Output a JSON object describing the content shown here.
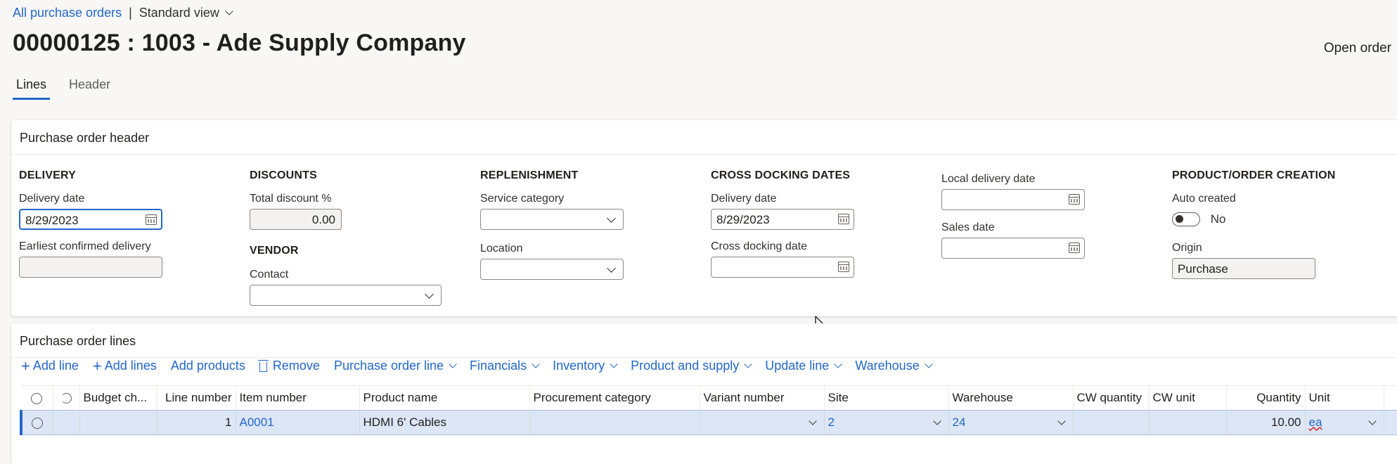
{
  "breadcrumb": {
    "link": "All purchase orders",
    "separator": "|",
    "view": "Standard view"
  },
  "page_title": "00000125 : 1003 - Ade Supply Company",
  "status": "Open order",
  "tabs": [
    "Lines",
    "Header"
  ],
  "header_section": {
    "title": "Purchase order header",
    "delivery": {
      "group": "DELIVERY",
      "delivery_date_label": "Delivery date",
      "delivery_date_value": "8/29/2023",
      "earliest_confirmed_label": "Earliest confirmed delivery",
      "earliest_confirmed_value": ""
    },
    "discounts": {
      "group": "DISCOUNTS",
      "total_discount_label": "Total discount %",
      "total_discount_value": "0.00"
    },
    "vendor": {
      "group": "VENDOR",
      "contact_label": "Contact",
      "contact_value": ""
    },
    "replenishment": {
      "group": "REPLENISHMENT",
      "service_category_label": "Service category",
      "service_category_value": "",
      "location_label": "Location",
      "location_value": ""
    },
    "cross_docking": {
      "group": "CROSS DOCKING DATES",
      "delivery_date_label": "Delivery date",
      "delivery_date_value": "8/29/2023",
      "cross_docking_date_label": "Cross docking date",
      "cross_docking_date_value": ""
    },
    "local_dates": {
      "local_delivery_label": "Local delivery date",
      "local_delivery_value": "",
      "sales_date_label": "Sales date",
      "sales_date_value": ""
    },
    "product_order": {
      "group": "PRODUCT/ORDER CREATION",
      "auto_created_label": "Auto created",
      "auto_created_value": "No",
      "origin_label": "Origin",
      "origin_value": "Purchase"
    }
  },
  "lines_section": {
    "title": "Purchase order lines",
    "toolbar": {
      "add_line": "Add line",
      "add_lines": "Add lines",
      "add_products": "Add products",
      "remove": "Remove",
      "po_line": "Purchase order line",
      "financials": "Financials",
      "inventory": "Inventory",
      "product_supply": "Product and supply",
      "update_line": "Update line",
      "warehouse": "Warehouse"
    },
    "columns": [
      "Budget ch...",
      "Line number",
      "Item number",
      "Product name",
      "Procurement category",
      "Variant number",
      "Site",
      "Warehouse",
      "CW quantity",
      "CW unit",
      "Quantity",
      "Unit"
    ],
    "rows": [
      {
        "budget": "",
        "line_number": "1",
        "item_number": "A0001",
        "product_name": "HDMI 6' Cables",
        "procurement_category": "",
        "variant_number": "",
        "site": "2",
        "warehouse": "24",
        "cw_quantity": "",
        "cw_unit": "",
        "quantity": "10.00",
        "unit": "ea"
      }
    ]
  }
}
